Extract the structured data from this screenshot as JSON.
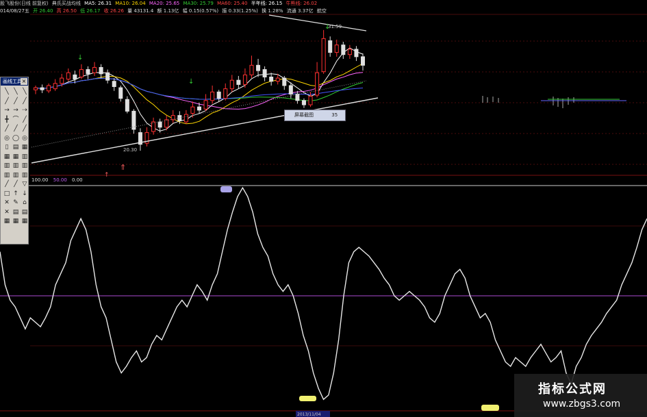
{
  "header": {
    "line1": [
      "股飞股份(日线 前复权)",
      "典氏买战均线",
      "MA5: 26.31",
      "MA10: 26.04",
      "MA20: 25.65",
      "MA30: 25.79",
      "MA60: 25.40",
      "半年线: 26.15",
      "牛熊线: 26.02"
    ],
    "line2": [
      "014/08/27五",
      "开 26.40",
      "高 26.50",
      "低 26.17",
      "收 26.26",
      "量 43131.4",
      "额 1.13亿",
      "幅 0.15(0.57%)",
      "振 0.33(1.25%)",
      "换 1.28%",
      "流通 3.37亿",
      "航空"
    ]
  },
  "indicator_header": [
    "100.00",
    "50.00",
    "0.00"
  ],
  "toolbox": {
    "title": "画线工具",
    "close": "×",
    "tools": [
      "╲",
      "╲",
      "╲",
      "╱",
      "╱",
      "╱",
      "→",
      "→",
      "⇢",
      "╋",
      "⌒",
      "╱",
      "╱",
      "╱",
      "╱",
      "◎",
      "◯",
      "◎",
      "▯",
      "▤",
      "▦",
      "▦",
      "▦",
      "▥",
      "▥",
      "▥",
      "▥",
      "▥",
      "▥",
      "▥",
      "╱",
      "╱",
      "▽",
      "□",
      "↑",
      "↓",
      "✕",
      "✎",
      "⌂",
      "✕",
      "▤",
      "▤",
      "▦",
      "▦",
      "▦"
    ]
  },
  "annotations": {
    "price_high": "31.59",
    "price_low": "20.30",
    "label_box_text": "屏幕截图",
    "label_box_value": "35",
    "bottom_date": "2013/11/04"
  },
  "watermark": {
    "title": "指标公式网",
    "url": "www.zbgs3.com"
  },
  "colors": {
    "background": "#000000",
    "oscillator": "#e8e8e8",
    "purple_line": "#8a3ea8",
    "up_candle": "#ff3030",
    "down_candle": "#e0e0e0"
  },
  "chart_data": [
    {
      "type": "candlestick",
      "title": "",
      "ylim": [
        18,
        33
      ],
      "note_high": 31.59,
      "note_low": 20.3,
      "candles": [
        [
          26.0,
          26.2,
          25.6,
          26.4
        ],
        [
          26.2,
          26.0,
          25.7,
          26.5
        ],
        [
          25.9,
          26.4,
          25.7,
          26.6
        ],
        [
          26.1,
          26.6,
          25.9,
          27.0
        ],
        [
          26.6,
          27.1,
          26.3,
          27.5
        ],
        [
          27.0,
          27.6,
          26.8,
          28.0
        ],
        [
          27.4,
          27.0,
          26.6,
          27.8
        ],
        [
          27.2,
          27.9,
          27.0,
          28.4
        ],
        [
          27.9,
          27.5,
          27.0,
          28.2
        ],
        [
          27.6,
          28.1,
          27.3,
          28.6
        ],
        [
          28.1,
          27.5,
          27.1,
          28.4
        ],
        [
          27.6,
          26.9,
          26.6,
          27.9
        ],
        [
          26.8,
          26.3,
          25.9,
          27.1
        ],
        [
          26.2,
          25.2,
          24.9,
          26.4
        ],
        [
          25.1,
          24.0,
          23.8,
          25.4
        ],
        [
          24.0,
          22.3,
          21.9,
          24.2
        ],
        [
          22.0,
          20.9,
          20.3,
          22.4
        ],
        [
          21.0,
          22.0,
          20.7,
          22.5
        ],
        [
          22.1,
          23.0,
          21.8,
          23.4
        ],
        [
          23.0,
          22.5,
          22.0,
          23.3
        ],
        [
          22.5,
          23.2,
          22.2,
          23.6
        ],
        [
          23.2,
          23.6,
          22.9,
          24.1
        ],
        [
          23.6,
          23.1,
          22.8,
          24.0
        ],
        [
          23.0,
          23.7,
          22.8,
          24.1
        ],
        [
          23.8,
          24.4,
          23.4,
          24.9
        ],
        [
          24.4,
          24.1,
          23.8,
          24.8
        ],
        [
          24.2,
          25.0,
          24.0,
          25.6
        ],
        [
          25.0,
          25.8,
          24.7,
          26.4
        ],
        [
          25.8,
          25.2,
          24.9,
          26.0
        ],
        [
          25.2,
          26.1,
          25.0,
          26.6
        ],
        [
          26.1,
          26.9,
          25.8,
          27.4
        ],
        [
          26.9,
          26.5,
          26.1,
          27.3
        ],
        [
          26.5,
          27.4,
          26.2,
          28.0
        ],
        [
          27.4,
          28.3,
          27.1,
          29.2
        ],
        [
          28.3,
          27.8,
          27.2,
          28.9
        ],
        [
          27.9,
          27.2,
          26.8,
          28.2
        ],
        [
          27.2,
          26.8,
          26.4,
          27.6
        ],
        [
          26.8,
          27.1,
          26.5,
          27.5
        ],
        [
          27.1,
          26.4,
          26.0,
          27.3
        ],
        [
          26.4,
          25.6,
          25.2,
          26.7
        ],
        [
          25.6,
          25.0,
          24.7,
          25.9
        ],
        [
          25.0,
          24.6,
          24.3,
          25.2
        ],
        [
          24.6,
          25.4,
          24.4,
          25.8
        ],
        [
          25.5,
          27.6,
          25.3,
          28.6
        ],
        [
          27.7,
          30.8,
          27.5,
          31.6
        ],
        [
          30.6,
          29.5,
          29.1,
          31.0
        ],
        [
          29.5,
          30.2,
          29.1,
          30.7
        ],
        [
          30.2,
          29.3,
          28.9,
          30.5
        ],
        [
          29.3,
          29.8,
          28.9,
          30.2
        ],
        [
          29.8,
          29.1,
          28.7,
          30.1
        ],
        [
          29.1,
          28.3,
          27.8,
          29.4
        ]
      ]
    },
    {
      "type": "line",
      "title": "",
      "ylim": [
        0,
        100
      ],
      "reference_lines": [
        100,
        50
      ],
      "series": [
        {
          "values": [
            70,
            55,
            48,
            45,
            40,
            35,
            40,
            38,
            36,
            40,
            45,
            55,
            60,
            65,
            75,
            80,
            85,
            80,
            70,
            55,
            45,
            40,
            30,
            20,
            15,
            18,
            22,
            25,
            20,
            22,
            28,
            32,
            30,
            35,
            40,
            45,
            48,
            45,
            50,
            55,
            52,
            48,
            55,
            60,
            70,
            80,
            88,
            95,
            99,
            95,
            88,
            78,
            72,
            68,
            60,
            55,
            52,
            55,
            50,
            42,
            32,
            25,
            15,
            8,
            3,
            5,
            15,
            30,
            50,
            65,
            70,
            72,
            70,
            68,
            65,
            62,
            58,
            55,
            50,
            48,
            50,
            52,
            50,
            48,
            45,
            40,
            38,
            42,
            50,
            55,
            60,
            62,
            58,
            50,
            45,
            40,
            42,
            38,
            30,
            25,
            20,
            18,
            22,
            20,
            18,
            22,
            25,
            28,
            24,
            20,
            22,
            25,
            15,
            10,
            18,
            22,
            28,
            32,
            35,
            38,
            42,
            45,
            48,
            55,
            60,
            65,
            72,
            80,
            85
          ]
        }
      ]
    }
  ]
}
